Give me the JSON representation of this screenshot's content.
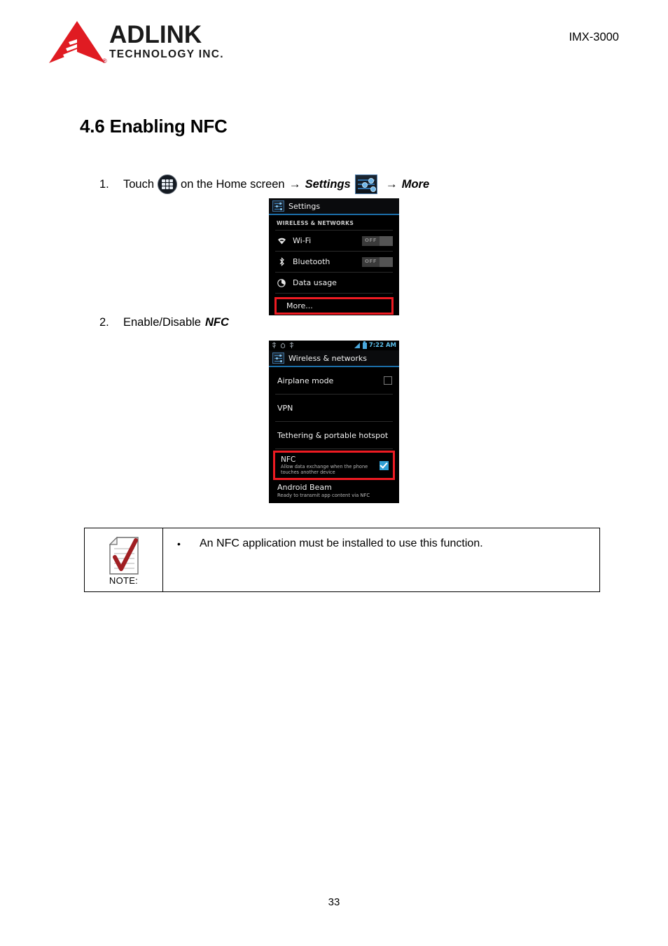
{
  "header": {
    "logo_primary": "ADLINK",
    "logo_secondary": "TECHNOLOGY INC.",
    "logo_registered": "®",
    "model": "IMX-3000",
    "logo_red": "#e01b22"
  },
  "section": {
    "heading": "4.6 Enabling NFC"
  },
  "steps": [
    {
      "number": "1.",
      "text_before": "Touch",
      "icon_1": "app-drawer-icon",
      "text_middle": "on the Home screen",
      "arrow_1": "→",
      "emphasis_1": "Settings",
      "icon_2": "settings-sliders-icon",
      "arrow_2": "→",
      "emphasis_2": "More"
    },
    {
      "number": "2.",
      "text_before": "Enable/Disable",
      "emphasis_1": "NFC"
    }
  ],
  "screenshot_settings": {
    "title": "Settings",
    "group_label": "WIRELESS & NETWORKS",
    "rows": [
      {
        "label": "Wi-Fi",
        "icon": "wifi-icon",
        "toggle": "OFF"
      },
      {
        "label": "Bluetooth",
        "icon": "bluetooth-icon",
        "toggle": "OFF"
      },
      {
        "label": "Data usage",
        "icon": "data-usage-icon",
        "toggle": ""
      }
    ],
    "highlighted_row": "More...",
    "highlight_color": "#ee1b22"
  },
  "screenshot_wireless": {
    "statusbar": {
      "time": "7:22 AM",
      "left_icons": [
        "usb-icon",
        "debug-icon",
        "usb-icon"
      ],
      "right_icons": [
        "signal-icon",
        "battery-icon"
      ]
    },
    "title": "Wireless & networks",
    "rows": [
      {
        "label": "Airplane mode",
        "control": "checkbox-unchecked"
      },
      {
        "label": "VPN",
        "control": "none"
      },
      {
        "label": "Tethering & portable hotspot",
        "control": "none"
      }
    ],
    "highlighted_row": {
      "title": "NFC",
      "subtitle": "Allow data exchange when the phone touches another device",
      "control": "checkbox-checked"
    },
    "last_row": {
      "title": "Android Beam",
      "subtitle": "Ready to transmit app content via NFC"
    },
    "highlight_color": "#ee1b22",
    "accent_color": "#2f9fd4"
  },
  "note": {
    "label": "NOTE:",
    "icon": "note-document-check-icon",
    "bullet": "•",
    "text": "An NFC application must be installed to use this function.",
    "check_color": "#a01e22"
  },
  "footer": {
    "page_number": "33"
  }
}
